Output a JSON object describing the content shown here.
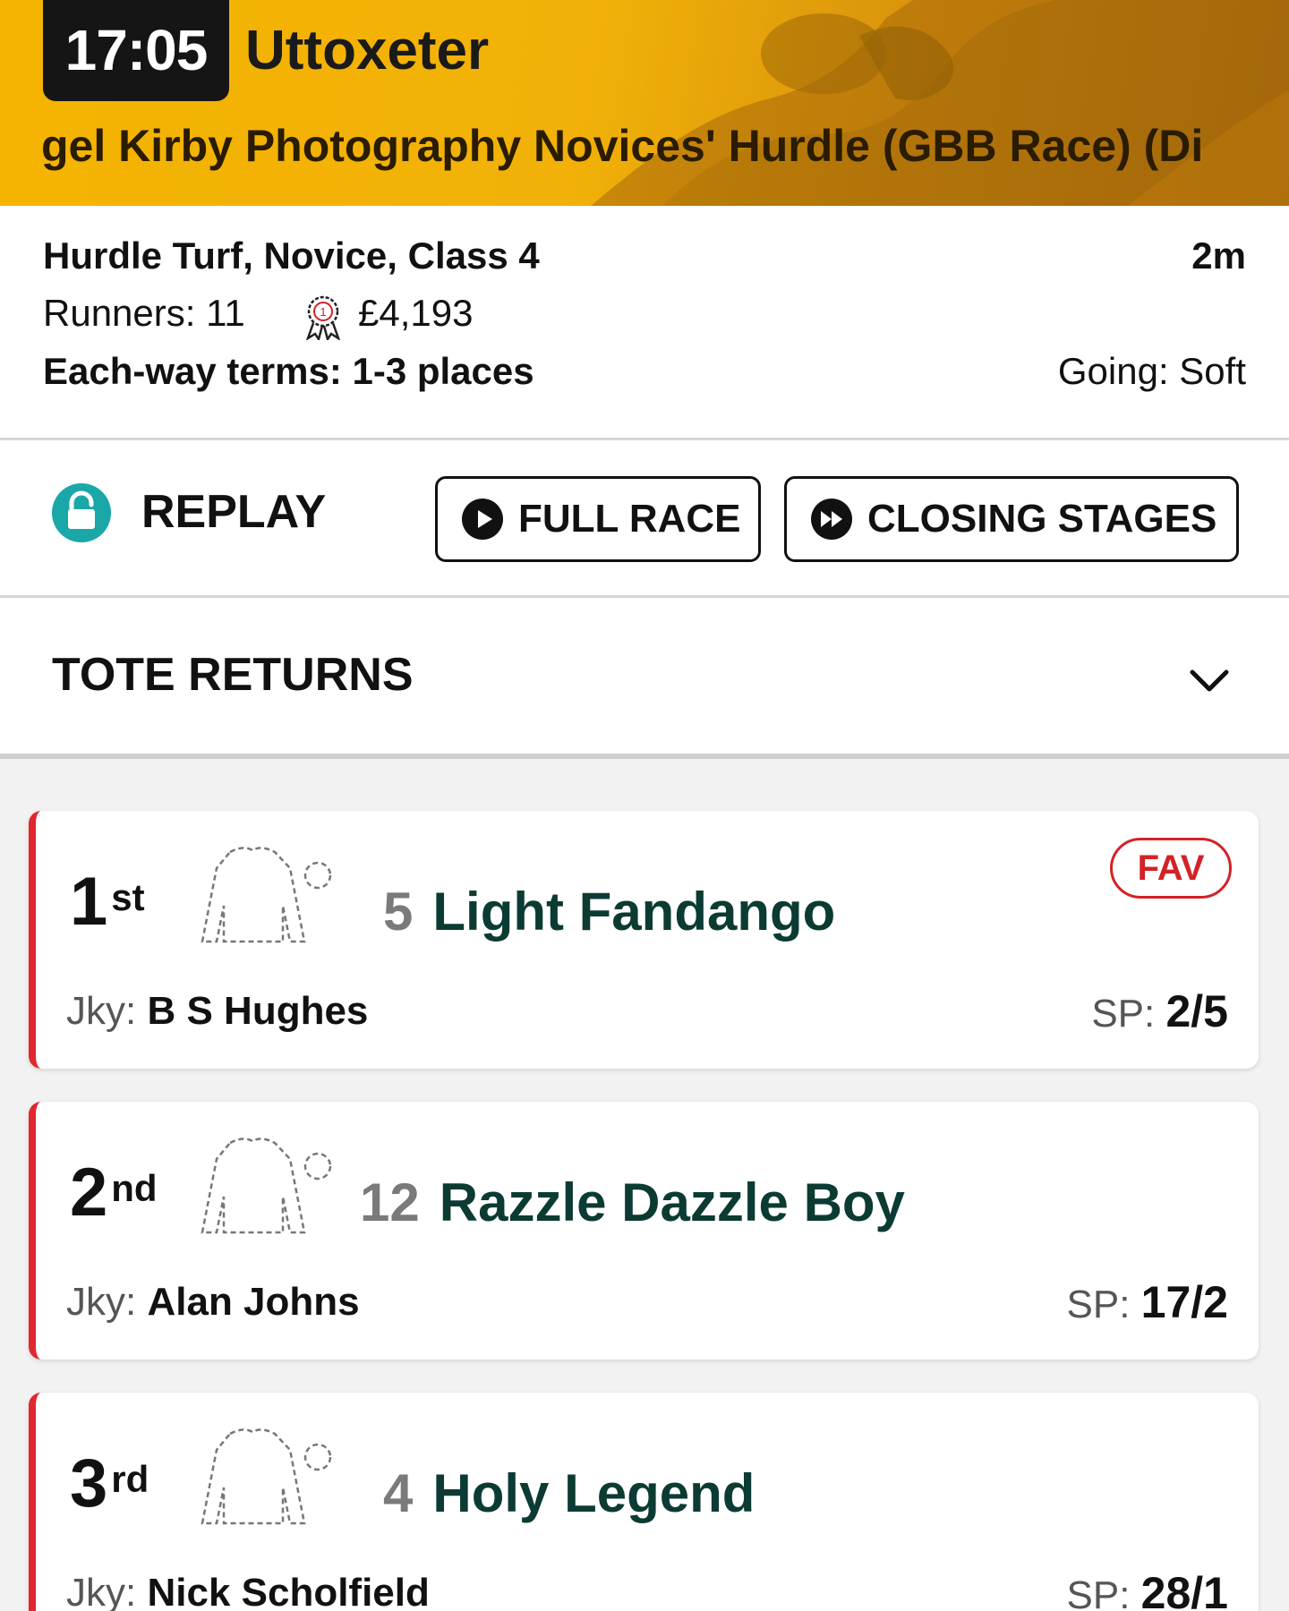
{
  "header": {
    "time": "17:05",
    "course": "Uttoxeter",
    "race_title": "gel Kirby Photography Novices' Hurdle (GBB Race) (Di"
  },
  "race_info": {
    "type": "Hurdle Turf, Novice, Class 4",
    "distance": "2m",
    "runners": "Runners: 11",
    "prize": "£4,193",
    "each_way": "Each-way terms: 1-3 places",
    "going": "Going: Soft"
  },
  "replay": {
    "label": "REPLAY",
    "full_race": "FULL RACE",
    "closing_stages": "CLOSING STAGES"
  },
  "tote": {
    "label": "TOTE RETURNS"
  },
  "results": [
    {
      "pos": "1",
      "suffix": "st",
      "number": "5",
      "horse": "Light Fandango",
      "fav": "FAV",
      "jky_label": "Jky:",
      "jockey": "B S Hughes",
      "sp_label": "SP:",
      "sp": "2/5"
    },
    {
      "pos": "2",
      "suffix": "nd",
      "number": "12",
      "horse": "Razzle Dazzle Boy",
      "fav": "",
      "jky_label": "Jky:",
      "jockey": "Alan Johns",
      "sp_label": "SP:",
      "sp": "17/2"
    },
    {
      "pos": "3",
      "suffix": "rd",
      "number": "4",
      "horse": "Holy Legend",
      "fav": "",
      "jky_label": "Jky:",
      "jockey": "Nick Scholfield",
      "sp_label": "SP:",
      "sp": "28/1"
    }
  ],
  "colors": {
    "banner": "#f4b400",
    "accent_red": "#e0282e",
    "horse_name": "#0b3b33",
    "lock_teal": "#1aa7a8"
  },
  "icons": {
    "lock": "lock-icon",
    "play": "play-icon",
    "fast_forward": "fast-forward-icon",
    "chevron": "chevron-down-icon",
    "prize": "rosette-icon",
    "silk": "jockey-silk-icon"
  }
}
